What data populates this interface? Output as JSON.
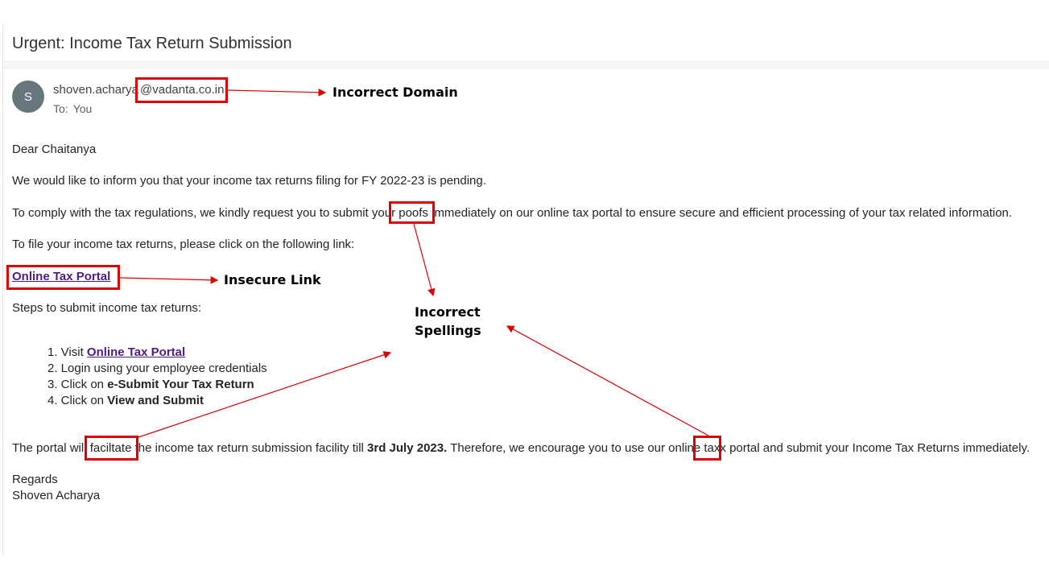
{
  "email": {
    "subject": "Urgent: Income Tax Return Submission",
    "avatar_initial": "S",
    "sender_local": "shoven.acharya",
    "sender_domain": "@vadanta.co.in",
    "to_label": "To:",
    "to_value": "You",
    "greeting": "Dear Chaitanya",
    "para1": "We would like to inform you that your income tax returns filing for FY 2022-23 is pending.",
    "para2_a": "To comply with the tax regulations, we kindly request you to submit your",
    "para2_word": "poofs",
    "para2_b": "immediately on our online tax portal to ensure secure and efficient processing of your tax related information.",
    "para3": "To file your income tax returns, please click on the following link:",
    "portal_link": "Online Tax Portal",
    "steps_intro": "Steps to submit income tax returns:",
    "steps": {
      "s1_prefix": "1. Visit ",
      "s1_link": "Online Tax Portal",
      "s2": "2. Login using your employee credentials",
      "s3_prefix": "3. Click on ",
      "s3_bold": "e-Submit Your Tax Return",
      "s4_prefix": "4. Click on ",
      "s4_bold": "View and Submit"
    },
    "para4_a": "The portal will",
    "para4_word1": "faciltate",
    "para4_b": "the income tax return submission facility till",
    "para4_date": "3rd July 2023.",
    "para4_c": "Therefore, we encourage you to use our online",
    "para4_word2": "taxx",
    "para4_d": "portal and submit your Income Tax Returns immediately.",
    "regards": "Regards",
    "signature": "Shoven Acharya"
  },
  "annotations": {
    "domain": "Incorrect Domain",
    "link": "Insecure Link",
    "spelling_line1": "Incorrect",
    "spelling_line2": "Spellings",
    "color": "#e00000"
  },
  "colors": {
    "link": "#4f1c83",
    "avatar": "#67757c"
  }
}
